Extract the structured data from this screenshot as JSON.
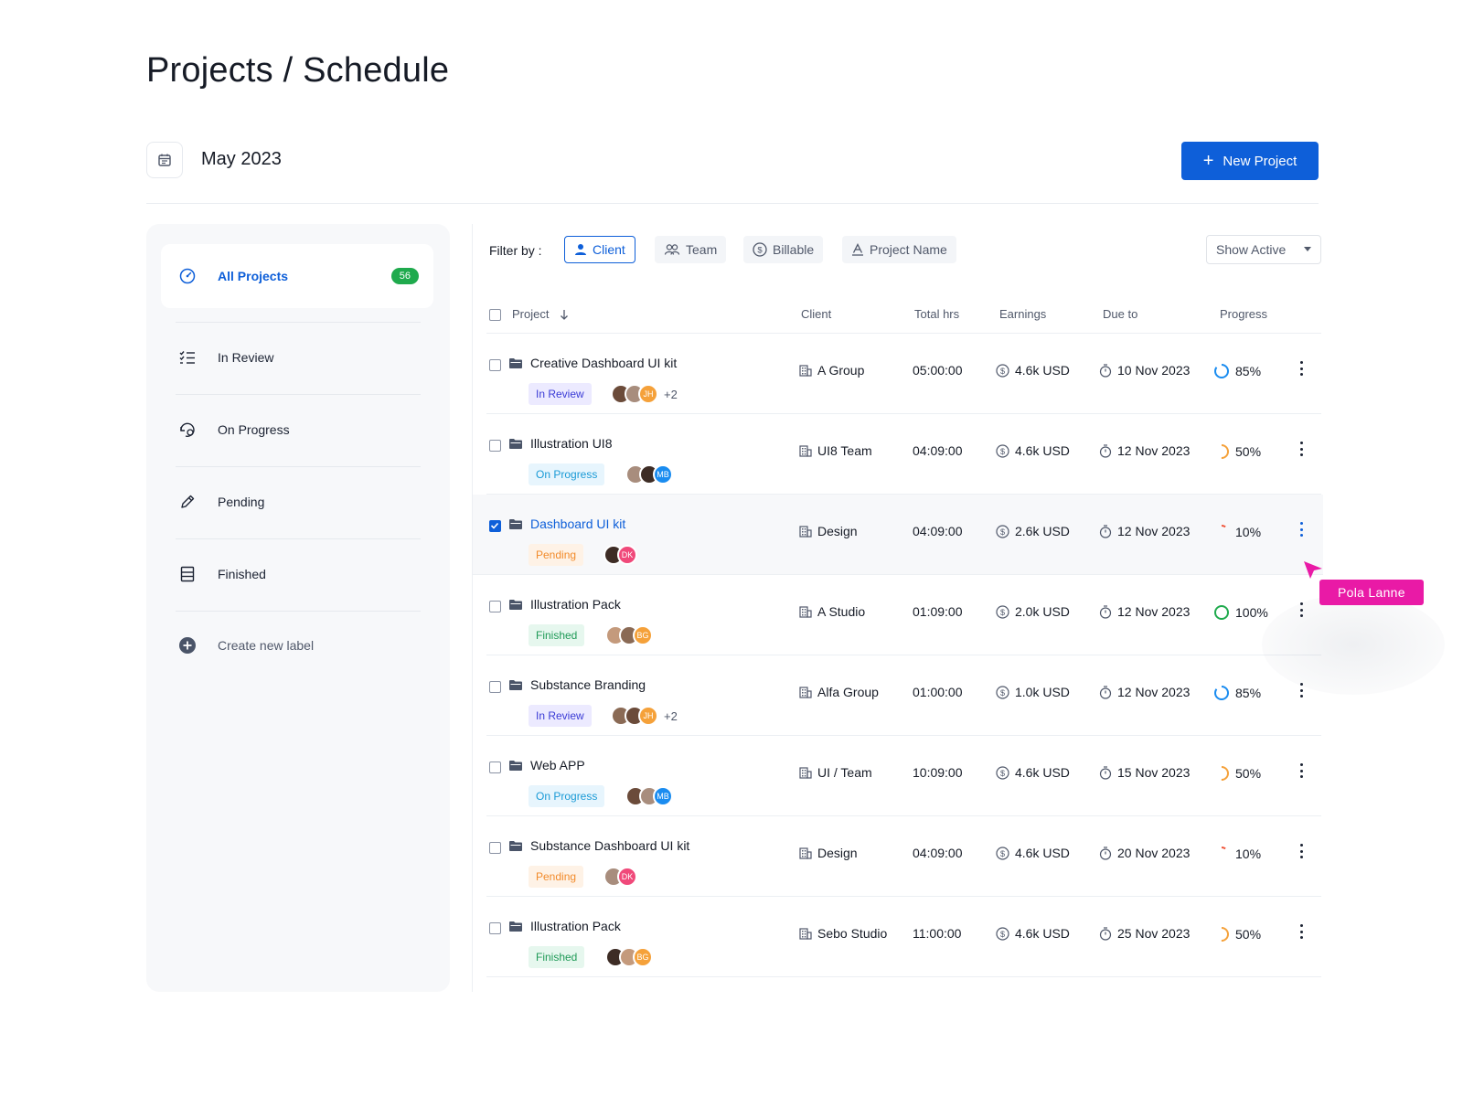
{
  "page": {
    "title": "Projects / Schedule"
  },
  "date_bar": {
    "month": "May 2023",
    "new_button": "New Project",
    "plus": "+"
  },
  "sidebar": {
    "items": [
      {
        "label": "All Projects",
        "count": "56",
        "icon": "dashboard-gauge-icon",
        "active": true
      },
      {
        "label": "In Review",
        "icon": "checklist-icon"
      },
      {
        "label": "On Progress",
        "icon": "progress-refresh-icon"
      },
      {
        "label": "Pending",
        "icon": "pencil-icon"
      },
      {
        "label": "Finished",
        "icon": "archive-icon"
      },
      {
        "label": "Create new label",
        "icon": "plus-circle-icon"
      }
    ]
  },
  "filters": {
    "label": "Filter by :",
    "chips": [
      {
        "label": "Client",
        "icon": "user-icon",
        "active": true
      },
      {
        "label": "Team",
        "icon": "team-icon"
      },
      {
        "label": "Billable",
        "icon": "dollar-circle-icon"
      },
      {
        "label": "Project Name",
        "icon": "text-a-icon"
      }
    ],
    "show_active": "Show Active"
  },
  "table": {
    "headers": {
      "project": "Project",
      "client": "Client",
      "total_hrs": "Total hrs",
      "earnings": "Earnings",
      "due_to": "Due to",
      "progress": "Progress"
    },
    "rows": [
      {
        "name": "Creative Dashboard UI kit",
        "status": "In Review",
        "avatars": [
          "",
          "",
          "JH"
        ],
        "more": "+2",
        "client": "A Group",
        "hrs": "05:00:00",
        "earnings": "4.6k USD",
        "due": "10 Nov 2023",
        "progress": "85%",
        "progress_value": 0.85,
        "checked": false
      },
      {
        "name": "Illustration UI8",
        "status": "On Progress",
        "avatars": [
          "",
          "",
          "MB"
        ],
        "more": "",
        "client": "UI8 Team",
        "hrs": "04:09:00",
        "earnings": "4.6k USD",
        "due": "12 Nov 2023",
        "progress": "50%",
        "progress_value": 0.5,
        "checked": false
      },
      {
        "name": "Dashboard UI kit",
        "status": "Pending",
        "avatars": [
          "",
          "DK"
        ],
        "more": "",
        "client": "Design",
        "hrs": "04:09:00",
        "earnings": "2.6k USD",
        "due": "12 Nov 2023",
        "progress": "10%",
        "progress_value": 0.1,
        "checked": true
      },
      {
        "name": "Illustration Pack",
        "status": "Finished",
        "avatars": [
          "",
          "",
          "BG"
        ],
        "more": "",
        "client": "A Studio",
        "hrs": "01:09:00",
        "earnings": "2.0k USD",
        "due": "12 Nov 2023",
        "progress": "100%",
        "progress_value": 1.0,
        "checked": false
      },
      {
        "name": "Substance  Branding",
        "status": "In Review",
        "avatars": [
          "",
          "",
          "JH"
        ],
        "more": "+2",
        "client": "Alfa Group",
        "hrs": "01:00:00",
        "earnings": "1.0k USD",
        "due": "12 Nov 2023",
        "progress": "85%",
        "progress_value": 0.85,
        "checked": false
      },
      {
        "name": "Web APP",
        "status": "On Progress",
        "avatars": [
          "",
          "",
          "MB"
        ],
        "more": "",
        "client": "UI / Team",
        "hrs": "10:09:00",
        "earnings": "4.6k USD",
        "due": "15 Nov 2023",
        "progress": "50%",
        "progress_value": 0.5,
        "checked": false
      },
      {
        "name": "Substance Dashboard UI kit",
        "status": "Pending",
        "avatars": [
          "",
          "DK"
        ],
        "more": "",
        "client": "Design",
        "hrs": "04:09:00",
        "earnings": "4.6k USD",
        "due": "20 Nov 2023",
        "progress": "10%",
        "progress_value": 0.1,
        "checked": false
      },
      {
        "name": "Illustration Pack",
        "status": "Finished",
        "avatars": [
          "",
          "",
          "BG"
        ],
        "more": "",
        "client": "Sebo Studio",
        "hrs": "11:00:00",
        "earnings": "4.6k USD",
        "due": "25 Nov 2023",
        "progress": "50%",
        "progress_value": 0.5,
        "checked": false
      }
    ]
  },
  "cursor_label": "Pola Lanne",
  "colors": {
    "accent": "#0e5fd9",
    "count_badge": "#1faa4d",
    "tooltip": "#e91aa6",
    "progress_85": "#1a8cf0",
    "progress_50": "#f5a13a",
    "progress_10": "#f0553a",
    "progress_100": "#1faa4d"
  }
}
